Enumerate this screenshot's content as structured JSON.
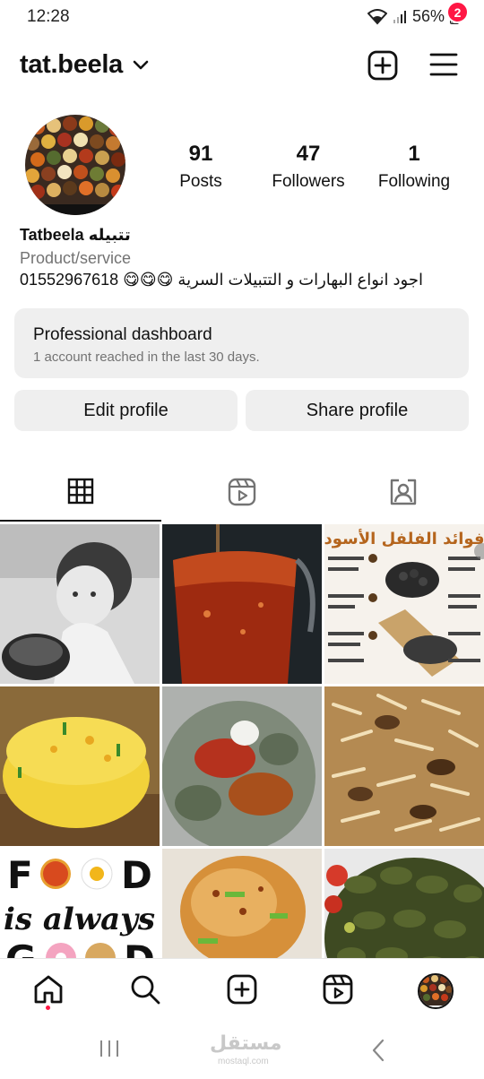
{
  "status_bar": {
    "time": "12:28",
    "battery": "56%"
  },
  "header": {
    "username": "tat.beela",
    "menu_badge": "2"
  },
  "profile": {
    "display_name": "Tatbeela تتبيله",
    "category": "Product/service",
    "bio": "اجود انواع البهارات و التتبيلات السرية 😋😋😋 01552967618",
    "stats": [
      {
        "value": "91",
        "label": "Posts"
      },
      {
        "value": "47",
        "label": "Followers"
      },
      {
        "value": "1",
        "label": "Following"
      }
    ]
  },
  "dashboard": {
    "title": "Professional dashboard",
    "subtitle": "1 account reached in the last 30 days."
  },
  "buttons": {
    "edit": "Edit profile",
    "share": "Share profile"
  },
  "tabs": [
    {
      "icon": "grid-icon"
    },
    {
      "icon": "reels-icon"
    },
    {
      "icon": "tagged-icon"
    }
  ],
  "posts": [
    {
      "text": ""
    },
    {
      "text": ""
    },
    {
      "text": "فوائد الفلفل الأسود"
    },
    {
      "text": ""
    },
    {
      "text": ""
    },
    {
      "text": ""
    },
    {
      "text": "FOOD is always a GOOD"
    },
    {
      "text": ""
    },
    {
      "text": ""
    }
  ],
  "bottom_nav": [
    "home-icon",
    "search-icon",
    "create-icon",
    "reels-icon",
    "profile-avatar"
  ],
  "watermark": "مستقل",
  "watermark_sub": "mostaql.com",
  "colors": {
    "badge": "#ff1744",
    "card_bg": "#efefef",
    "secondary_text": "#737373"
  }
}
